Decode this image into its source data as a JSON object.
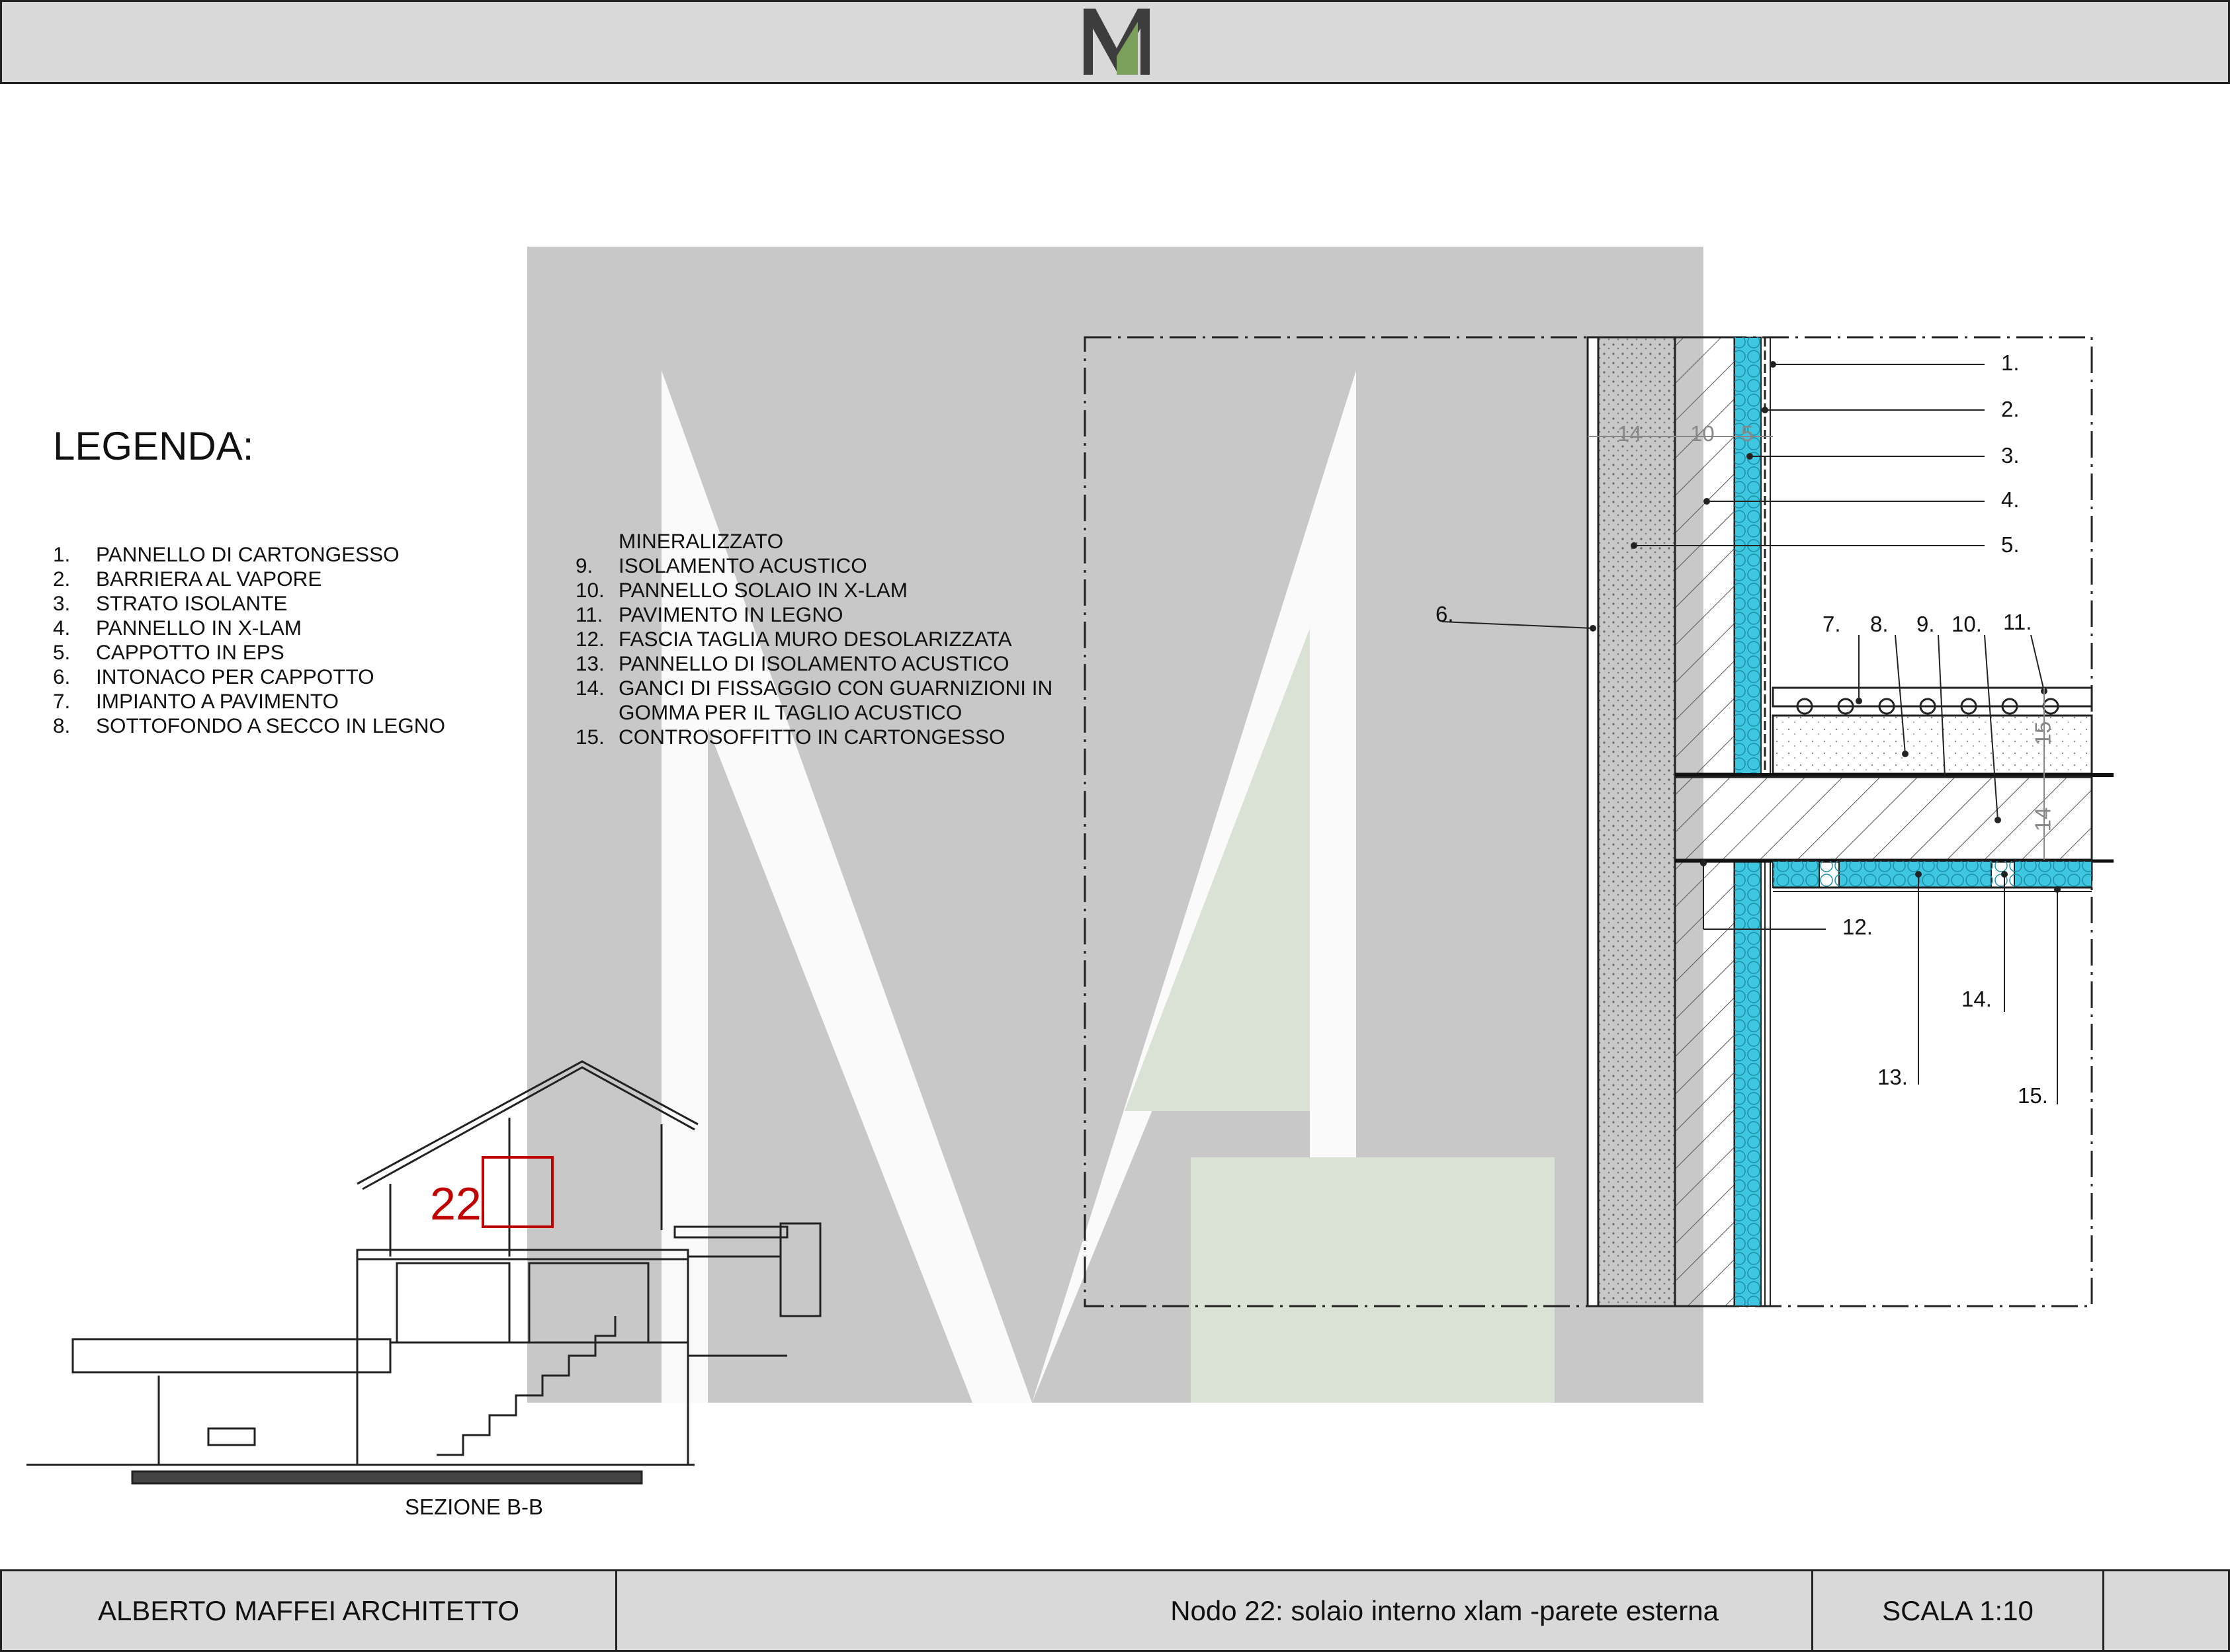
{
  "header": {
    "logo_letter": "M"
  },
  "legend": {
    "title": "LEGENDA:",
    "col1": [
      {
        "num": "1.",
        "text": "PANNELLO DI CARTONGESSO"
      },
      {
        "num": "2.",
        "text": "BARRIERA AL VAPORE"
      },
      {
        "num": "3.",
        "text": "STRATO ISOLANTE"
      },
      {
        "num": "4.",
        "text": "PANNELLO IN X-LAM"
      },
      {
        "num": "5.",
        "text": "CAPPOTTO IN  EPS"
      },
      {
        "num": "6.",
        "text": "INTONACO PER CAPPOTTO"
      },
      {
        "num": "7.",
        "text": "IMPIANTO A PAVIMENTO"
      },
      {
        "num": "8.",
        "text": "SOTTOFONDO A SECCO IN LEGNO"
      }
    ],
    "col2": [
      {
        "num": "",
        "text": "MINERALIZZATO"
      },
      {
        "num": "9.",
        "text": "ISOLAMENTO ACUSTICO"
      },
      {
        "num": "10.",
        "text": "PANNELLO SOLAIO IN X-LAM"
      },
      {
        "num": "11.",
        "text": "PAVIMENTO IN LEGNO"
      },
      {
        "num": "12.",
        "text": "FASCIA TAGLIA MURO DESOLARIZZATA"
      },
      {
        "num": "13.",
        "text": "PANNELLO DI ISOLAMENTO ACUSTICO"
      },
      {
        "num": "14.",
        "text": "GANCI DI FISSAGGIO CON GUARNIZIONI IN"
      },
      {
        "num": "",
        "text": "GOMMA PER IL TAGLIO ACUSTICO"
      },
      {
        "num": "15.",
        "text": "CONTROSOFFITTO IN CARTONGESSO"
      }
    ]
  },
  "detail": {
    "callouts": [
      "1.",
      "2.",
      "3.",
      "4.",
      "5.",
      "6.",
      "7.",
      "8.",
      "9.",
      "10.",
      "11.",
      "12.",
      "13.",
      "14.",
      "15."
    ],
    "dimensions": {
      "wall": [
        "14",
        "10",
        "5"
      ],
      "slab": [
        "15",
        "14"
      ]
    }
  },
  "section": {
    "caption": "SEZIONE B-B",
    "marker": "22"
  },
  "footer": {
    "architect": "ALBERTO MAFFEI ARCHITETTO",
    "title": "Nodo 22: solaio interno xlam -parete esterna",
    "scale": "SCALA 1:10"
  },
  "colors": {
    "insulation": "#3fc6e0",
    "marker": "#c00000",
    "watermark_gray": "#c8c8c8",
    "watermark_green": "#d9e2d5",
    "frame": "#d9d9d9"
  }
}
